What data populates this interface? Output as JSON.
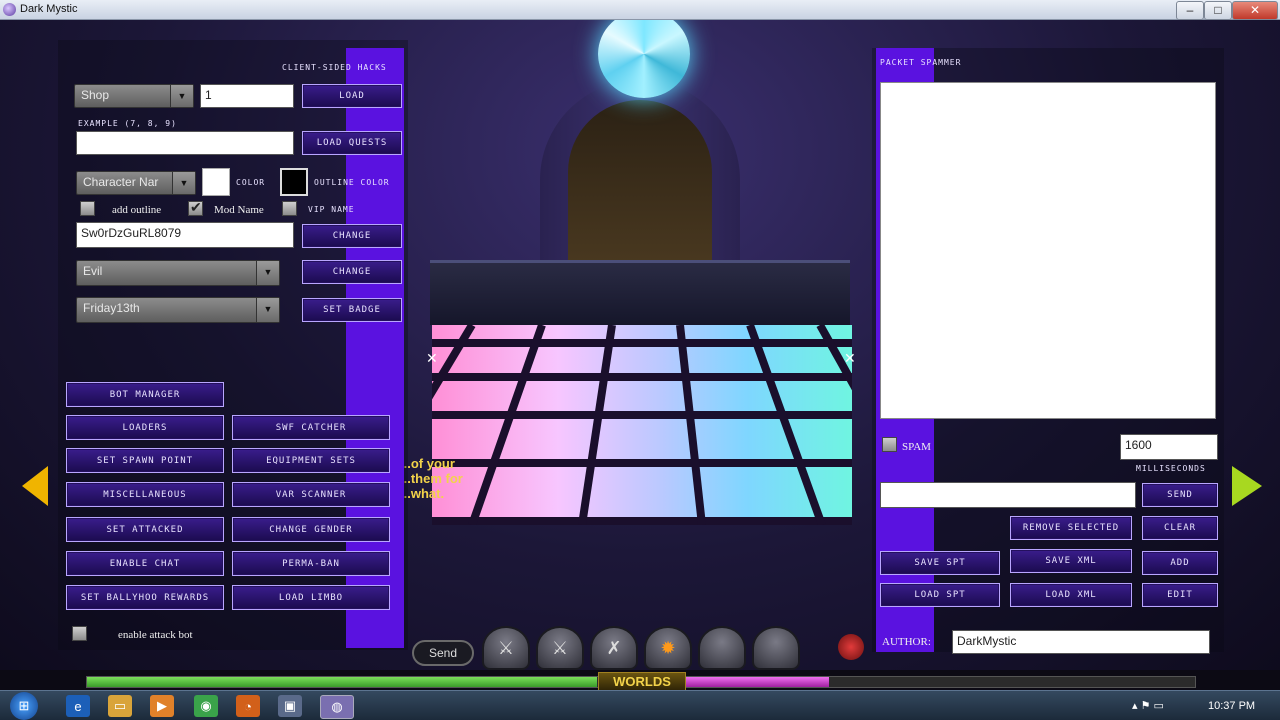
{
  "window": {
    "title": "Dark Mystic",
    "buttons": [
      "–",
      "□",
      "✕"
    ]
  },
  "left_panel": {
    "header": "CLIENT-SIDED HACKS",
    "shop_select": "Shop",
    "quantity_value": "1",
    "load_button": "LOAD",
    "example_label": "EXAMPLE (7, 8, 9)",
    "quests_input_value": "",
    "load_quests_button": "LOAD QUESTS",
    "name_select": "Character Nar",
    "color_label": "COLOR",
    "outline_color_label": "OUTLINE COLOR",
    "add_outline_label": "add outline",
    "mod_name_label": "Mod Name",
    "vip_name_label": "VIP NAME",
    "name_input_value": "Sw0rDzGuRL8079",
    "change_button_1": "CHANGE",
    "alignment_select": "Evil",
    "change_button_2": "CHANGE",
    "badge_select": "Friday13th",
    "set_badge_button": "SET BADGE",
    "buttons": {
      "bot_manager": "BOT MANAGER",
      "loaders": "LOADERS",
      "swf_catcher": "SWF CATCHER",
      "set_spawn_point": "SET SPAWN POINT",
      "equipment_sets": "EQUIPMENT SETS",
      "miscellaneous": "MISCELLANEOUS",
      "var_scanner": "VAR SCANNER",
      "set_attacked": "SET ATTACKED",
      "change_gender": "CHANGE GENDER",
      "enable_chat": "ENABLE CHAT",
      "perma_ban": "PERMA-BAN",
      "set_ballyhoo_rewards": "SET BALLYHOO REWARDS",
      "load_limbo": "LOAD LIMBO"
    },
    "enable_attack_bot_label": "enable attack bot"
  },
  "right_panel": {
    "header": "PACKET SPAMMER",
    "spam_label": "SPAM",
    "interval_value": "1600",
    "milliseconds_label": "MILLISECONDS",
    "send_button": "SEND",
    "remove_selected_button": "REMOVE SELECTED",
    "clear_button": "CLEAR",
    "save_spt_button": "SAVE SPT",
    "save_xml_button": "SAVE XML",
    "add_button": "ADD",
    "load_spt_button": "LOAD SPT",
    "load_xml_button": "LOAD XML",
    "edit_button": "EDIT",
    "author_label": "AUTHOR:",
    "author_value": "DarkMystic"
  },
  "game": {
    "chat_snippet": "...of your\n...them for\n...what.",
    "chat_send_button": "Send",
    "worlds_label": "WORLDS"
  },
  "taskbar": {
    "clock": "10:37 PM",
    "icons": [
      "start-orb",
      "ie-icon",
      "folder-icon",
      "media-player-icon",
      "chrome-icon",
      "firefox-icon",
      "app-icon",
      "dark-mystic-icon"
    ]
  },
  "colors": {
    "panel_purple": "#5a12e0",
    "button_border": "#b9a6ff",
    "progress_green": "#4fc43a",
    "progress_magenta": "#d82bd8"
  }
}
